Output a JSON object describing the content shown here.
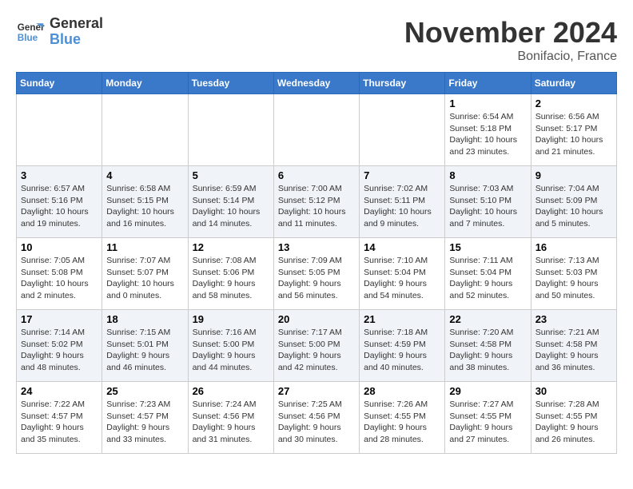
{
  "header": {
    "logo_line1": "General",
    "logo_line2": "Blue",
    "month": "November 2024",
    "location": "Bonifacio, France"
  },
  "days_of_week": [
    "Sunday",
    "Monday",
    "Tuesday",
    "Wednesday",
    "Thursday",
    "Friday",
    "Saturday"
  ],
  "weeks": [
    [
      {
        "day": "",
        "info": ""
      },
      {
        "day": "",
        "info": ""
      },
      {
        "day": "",
        "info": ""
      },
      {
        "day": "",
        "info": ""
      },
      {
        "day": "",
        "info": ""
      },
      {
        "day": "1",
        "info": "Sunrise: 6:54 AM\nSunset: 5:18 PM\nDaylight: 10 hours and 23 minutes."
      },
      {
        "day": "2",
        "info": "Sunrise: 6:56 AM\nSunset: 5:17 PM\nDaylight: 10 hours and 21 minutes."
      }
    ],
    [
      {
        "day": "3",
        "info": "Sunrise: 6:57 AM\nSunset: 5:16 PM\nDaylight: 10 hours and 19 minutes."
      },
      {
        "day": "4",
        "info": "Sunrise: 6:58 AM\nSunset: 5:15 PM\nDaylight: 10 hours and 16 minutes."
      },
      {
        "day": "5",
        "info": "Sunrise: 6:59 AM\nSunset: 5:14 PM\nDaylight: 10 hours and 14 minutes."
      },
      {
        "day": "6",
        "info": "Sunrise: 7:00 AM\nSunset: 5:12 PM\nDaylight: 10 hours and 11 minutes."
      },
      {
        "day": "7",
        "info": "Sunrise: 7:02 AM\nSunset: 5:11 PM\nDaylight: 10 hours and 9 minutes."
      },
      {
        "day": "8",
        "info": "Sunrise: 7:03 AM\nSunset: 5:10 PM\nDaylight: 10 hours and 7 minutes."
      },
      {
        "day": "9",
        "info": "Sunrise: 7:04 AM\nSunset: 5:09 PM\nDaylight: 10 hours and 5 minutes."
      }
    ],
    [
      {
        "day": "10",
        "info": "Sunrise: 7:05 AM\nSunset: 5:08 PM\nDaylight: 10 hours and 2 minutes."
      },
      {
        "day": "11",
        "info": "Sunrise: 7:07 AM\nSunset: 5:07 PM\nDaylight: 10 hours and 0 minutes."
      },
      {
        "day": "12",
        "info": "Sunrise: 7:08 AM\nSunset: 5:06 PM\nDaylight: 9 hours and 58 minutes."
      },
      {
        "day": "13",
        "info": "Sunrise: 7:09 AM\nSunset: 5:05 PM\nDaylight: 9 hours and 56 minutes."
      },
      {
        "day": "14",
        "info": "Sunrise: 7:10 AM\nSunset: 5:04 PM\nDaylight: 9 hours and 54 minutes."
      },
      {
        "day": "15",
        "info": "Sunrise: 7:11 AM\nSunset: 5:04 PM\nDaylight: 9 hours and 52 minutes."
      },
      {
        "day": "16",
        "info": "Sunrise: 7:13 AM\nSunset: 5:03 PM\nDaylight: 9 hours and 50 minutes."
      }
    ],
    [
      {
        "day": "17",
        "info": "Sunrise: 7:14 AM\nSunset: 5:02 PM\nDaylight: 9 hours and 48 minutes."
      },
      {
        "day": "18",
        "info": "Sunrise: 7:15 AM\nSunset: 5:01 PM\nDaylight: 9 hours and 46 minutes."
      },
      {
        "day": "19",
        "info": "Sunrise: 7:16 AM\nSunset: 5:00 PM\nDaylight: 9 hours and 44 minutes."
      },
      {
        "day": "20",
        "info": "Sunrise: 7:17 AM\nSunset: 5:00 PM\nDaylight: 9 hours and 42 minutes."
      },
      {
        "day": "21",
        "info": "Sunrise: 7:18 AM\nSunset: 4:59 PM\nDaylight: 9 hours and 40 minutes."
      },
      {
        "day": "22",
        "info": "Sunrise: 7:20 AM\nSunset: 4:58 PM\nDaylight: 9 hours and 38 minutes."
      },
      {
        "day": "23",
        "info": "Sunrise: 7:21 AM\nSunset: 4:58 PM\nDaylight: 9 hours and 36 minutes."
      }
    ],
    [
      {
        "day": "24",
        "info": "Sunrise: 7:22 AM\nSunset: 4:57 PM\nDaylight: 9 hours and 35 minutes."
      },
      {
        "day": "25",
        "info": "Sunrise: 7:23 AM\nSunset: 4:57 PM\nDaylight: 9 hours and 33 minutes."
      },
      {
        "day": "26",
        "info": "Sunrise: 7:24 AM\nSunset: 4:56 PM\nDaylight: 9 hours and 31 minutes."
      },
      {
        "day": "27",
        "info": "Sunrise: 7:25 AM\nSunset: 4:56 PM\nDaylight: 9 hours and 30 minutes."
      },
      {
        "day": "28",
        "info": "Sunrise: 7:26 AM\nSunset: 4:55 PM\nDaylight: 9 hours and 28 minutes."
      },
      {
        "day": "29",
        "info": "Sunrise: 7:27 AM\nSunset: 4:55 PM\nDaylight: 9 hours and 27 minutes."
      },
      {
        "day": "30",
        "info": "Sunrise: 7:28 AM\nSunset: 4:55 PM\nDaylight: 9 hours and 26 minutes."
      }
    ]
  ]
}
